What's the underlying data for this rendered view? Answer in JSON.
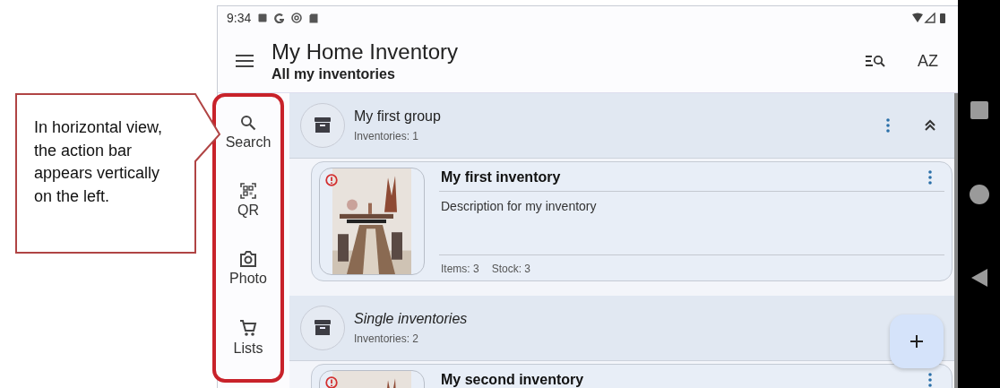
{
  "callout": {
    "text": "In horizontal view, the action bar appears vertically on the left."
  },
  "status_bar": {
    "time": "9:34"
  },
  "app_bar": {
    "title": "My Home Inventory",
    "subtitle": "All my inventories",
    "sort_label": "AZ"
  },
  "action_rail": [
    {
      "kind": "search",
      "label": "Search"
    },
    {
      "kind": "qr",
      "label": "QR"
    },
    {
      "label": "Photo"
    },
    {
      "kind": "cart",
      "label": "Lists"
    }
  ],
  "groups": [
    {
      "title": "My first group",
      "count": "Inventories: 1",
      "italic": false,
      "expanded": true,
      "inventories": [
        {
          "title": "My first inventory",
          "description": "Description for my inventory",
          "items": "Items: 3",
          "stock": "Stock: 3"
        }
      ]
    },
    {
      "title": "Single inventories",
      "count": "Inventories: 2",
      "italic": true,
      "inventories": [
        {
          "title": "My second inventory"
        }
      ]
    }
  ]
}
